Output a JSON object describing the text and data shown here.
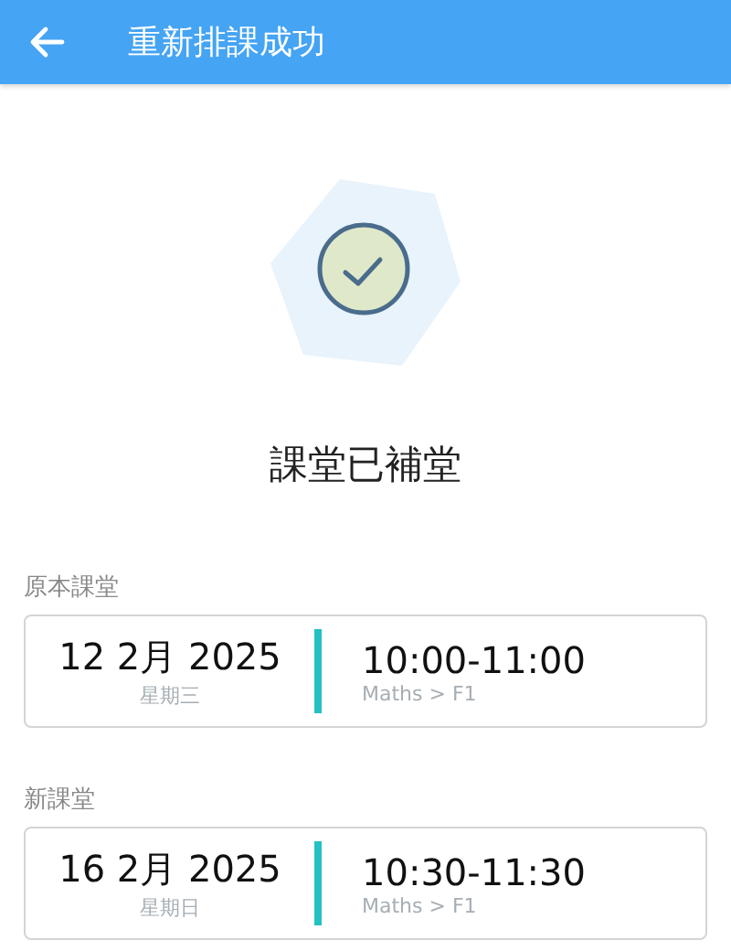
{
  "header": {
    "title": "重新排課成功"
  },
  "status": {
    "message": "課堂已補堂"
  },
  "lessons": [
    {
      "label": "原本課堂",
      "date": "12 2月 2025",
      "weekday": "星期三",
      "time": "10:00-11:00",
      "subject": "Maths > F1"
    },
    {
      "label": "新課堂",
      "date": "16 2月 2025",
      "weekday": "星期日",
      "time": "10:30-11:30",
      "subject": "Maths > F1"
    }
  ]
}
